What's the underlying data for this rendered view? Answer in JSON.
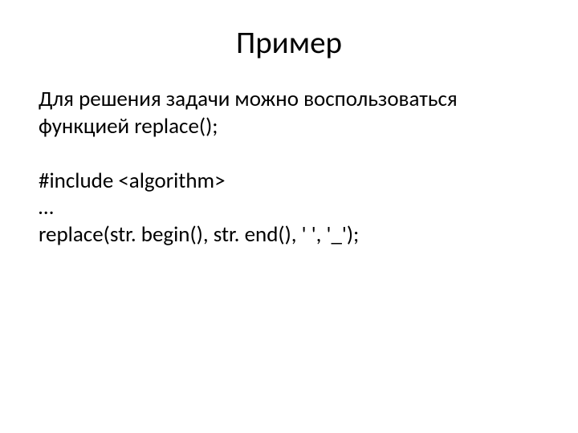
{
  "slide": {
    "title": "Пример",
    "intro": "Для решения задачи можно воспользоваться функцией replace();",
    "code": {
      "line1": "#include <algorithm>",
      "line2": "…",
      "line3": "replace(str. begin(), str. end(), ' ', '_');"
    }
  }
}
